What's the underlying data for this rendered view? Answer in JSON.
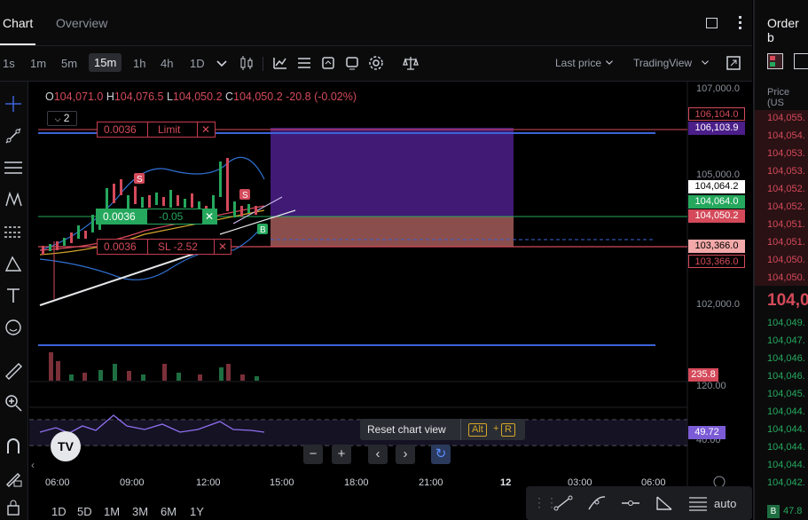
{
  "tabs": [
    {
      "label": "Chart",
      "active": true
    },
    {
      "label": "Overview",
      "active": false
    }
  ],
  "timeframes": [
    "1s",
    "1m",
    "5m",
    "15m",
    "1h",
    "4h",
    "1D"
  ],
  "selected_timeframe": "15m",
  "price_source": "Last price",
  "chart_engine": "TradingView",
  "ohlc": {
    "o_label": "O",
    "o": "104,071.0",
    "h_label": "H",
    "h": "104,076.5",
    "l_label": "L",
    "l": "104,050.2",
    "c_label": "C",
    "c": "104,050.2",
    "change": "-20.8 (-0.02%)"
  },
  "indicator_count": "2",
  "orders": {
    "limit": {
      "qty": "0.0036",
      "label": "Limit",
      "close": "✕"
    },
    "position": {
      "qty": "0.0036",
      "pnl": "-0.05",
      "close": "✕"
    },
    "stop_loss": {
      "qty": "0.0036",
      "label": "SL -2.52",
      "close": "✕"
    }
  },
  "price_axis": [
    "107,000.0",
    "105,000.0",
    "102,000.0"
  ],
  "price_tags": {
    "limit_outline": "106,104.0",
    "limit_fill": "106,103.9",
    "white": "104,064.2",
    "green": "104,064.0",
    "red": "104,050.2",
    "sl_fill": "103,366.0",
    "sl_outline": "103,366.0",
    "volume": "235.8",
    "rsi": "49.72"
  },
  "rsi_axis": [
    "120.00",
    "40.00"
  ],
  "time_axis": [
    "06:00",
    "09:00",
    "12:00",
    "15:00",
    "18:00",
    "21:00",
    "12",
    "03:00",
    "06:00"
  ],
  "tooltip": {
    "text": "Reset chart view",
    "key1": "Alt",
    "plus": "+",
    "key2": "R"
  },
  "zoom_buttons": {
    "minus": "−",
    "plus": "+",
    "left": "‹",
    "right": "›"
  },
  "ranges": [
    "1D",
    "5D",
    "1M",
    "3M",
    "6M",
    "1Y"
  ],
  "auto_label": "auto",
  "order_book": {
    "title": "Order b",
    "price_header": "Price (US",
    "asks": [
      "104,055.",
      "104,054.",
      "104,053.",
      "104,053.",
      "104,052.",
      "104,052.",
      "104,051.",
      "104,051.",
      "104,050.",
      "104,050."
    ],
    "mid": "104,0",
    "bids": [
      "104,049.",
      "104,047.",
      "104,046.",
      "104,046.",
      "104,045.",
      "104,044.",
      "104,044.",
      "104,044.",
      "104,044.",
      "104,042."
    ],
    "footer_badge": "B",
    "footer_value": "47.8"
  },
  "colors": {
    "bull": "#25a85d",
    "bear": "#d44a5a",
    "purple": "#4b1e8a",
    "blue": "#3d63d6"
  }
}
